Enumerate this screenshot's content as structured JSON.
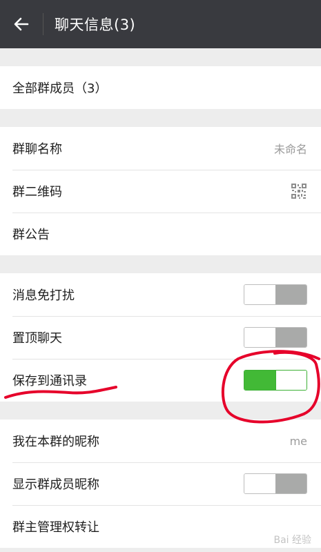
{
  "header": {
    "back_icon": "arrow-left-icon",
    "title": "聊天信息(3)"
  },
  "members": {
    "label": "全部群成员（3）"
  },
  "group": {
    "name_label": "群聊名称",
    "name_value": "未命名",
    "qrcode_label": "群二维码",
    "qrcode_icon": "qr-code-icon",
    "notice_label": "群公告"
  },
  "settings": {
    "mute_label": "消息免打扰",
    "mute_on": false,
    "pin_label": "置顶聊天",
    "pin_on": false,
    "save_label": "保存到通讯录",
    "save_on": true
  },
  "profile": {
    "nickname_label": "我在本群的昵称",
    "nickname_value": "me",
    "show_nick_label": "显示群成员昵称",
    "show_nick_on": false,
    "transfer_label": "群主管理权转让"
  },
  "colors": {
    "titlebar": "#393a3f",
    "toggle_on": "#42b936",
    "toggle_off": "#a9aaa9",
    "annotation": "#e6002a"
  },
  "watermark": "Bai 经验"
}
